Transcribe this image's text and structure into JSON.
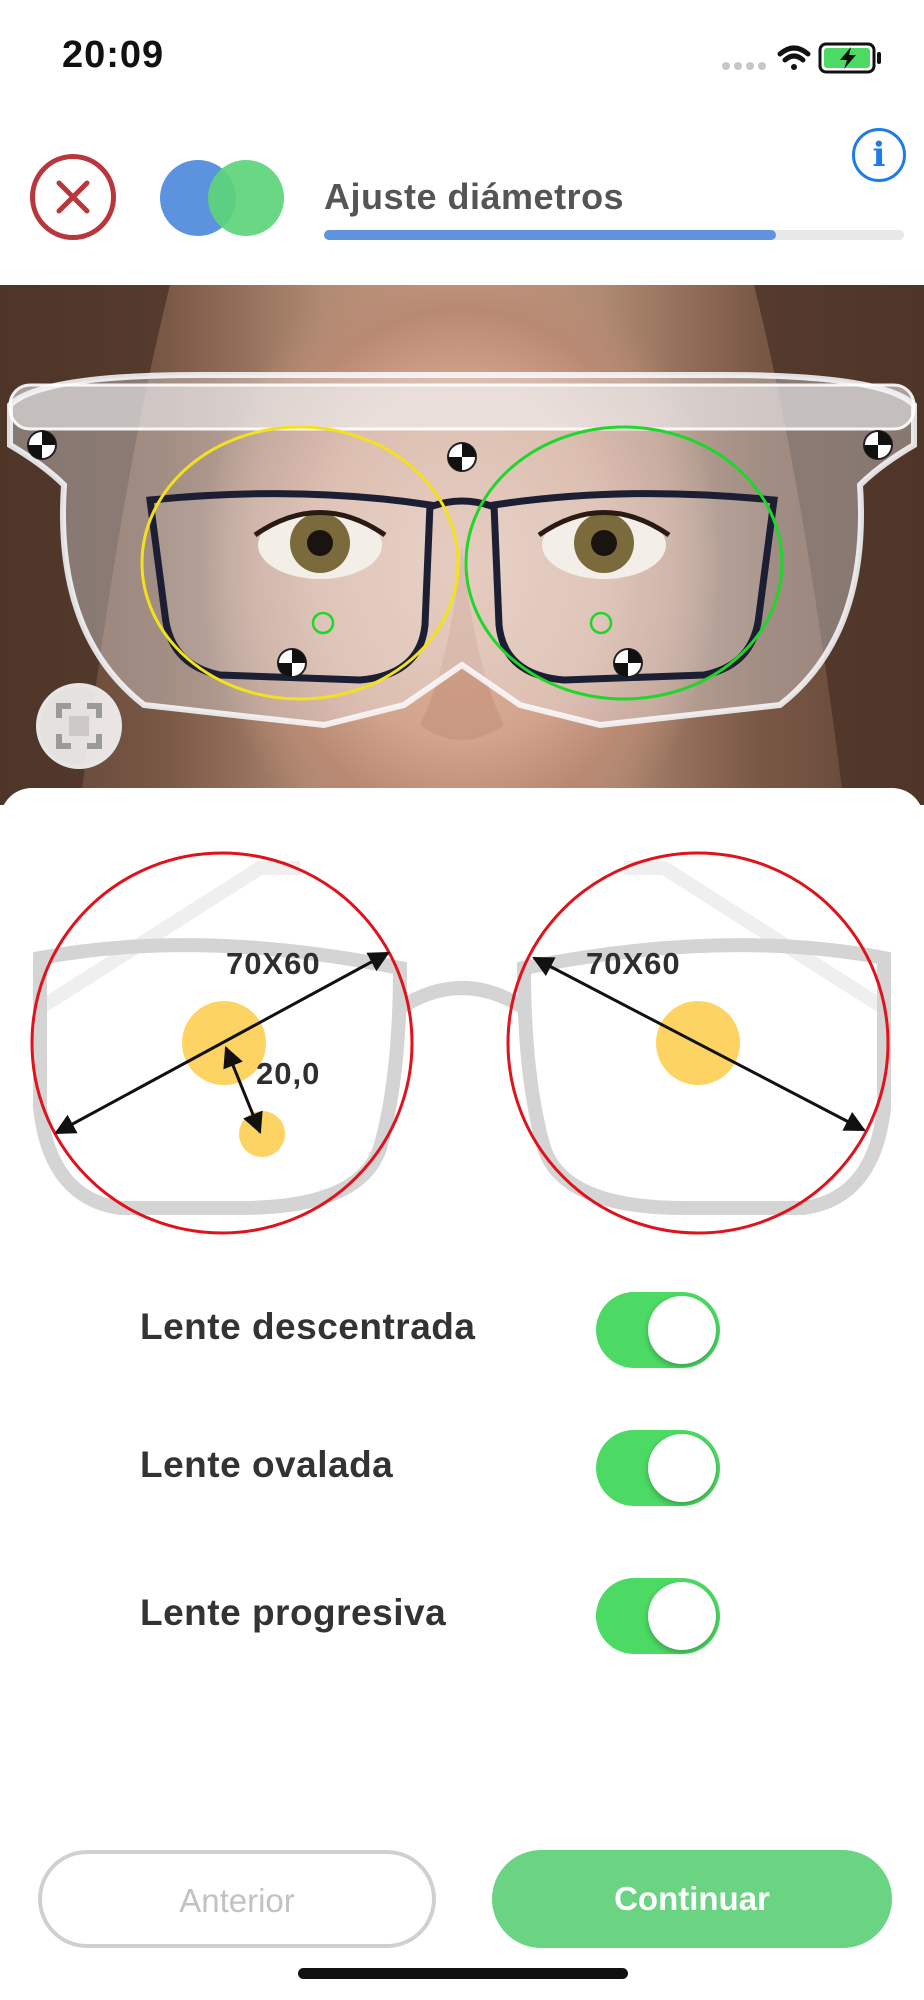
{
  "status_bar": {
    "time": "20:09"
  },
  "header": {
    "title": "Ajuste diámetros",
    "progress": 0.78,
    "info_label": "i"
  },
  "photo": {
    "left_frame_color": "#f2e21e",
    "right_frame_color": "#1fd62b"
  },
  "diagram": {
    "left_size": "70X60",
    "right_size": "70X60",
    "offset_label": "20,0",
    "circle_color": "#e0121b",
    "pupil_color": "#fdd463"
  },
  "toggles": [
    {
      "label": "Lente descentrada",
      "on": true
    },
    {
      "label": "Lente ovalada",
      "on": true
    },
    {
      "label": "Lente progresiva",
      "on": true
    }
  ],
  "buttons": {
    "previous": "Anterior",
    "next": "Continuar"
  }
}
